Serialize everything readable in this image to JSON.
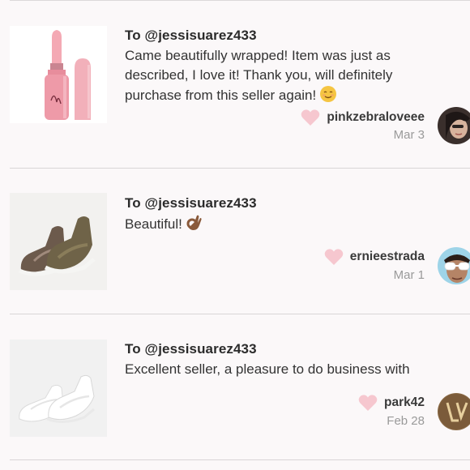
{
  "reviews": [
    {
      "to": "To @jessisuarez433",
      "text": "Came beautifully wrapped! Item was just as described, I love it! Thank you, will definitely purchase from this seller again!",
      "emoji": "relieved-smile-emoji",
      "username": "pinkzebraloveee",
      "date": "Mar 3",
      "thumb": "lipstick-image",
      "avatar": "user-photo-avatar"
    },
    {
      "to": "To @jessisuarez433",
      "text": "Beautiful!",
      "emoji": "ok-hand-emoji",
      "username": "ernieestrada",
      "date": "Mar 1",
      "thumb": "olive-sneakers-image",
      "avatar": "sunglasses-avatar"
    },
    {
      "to": "To @jessisuarez433",
      "text": "Excellent seller, a pleasure to do business with",
      "username": "park42",
      "date": "Feb 28",
      "thumb": "white-sneakers-image",
      "avatar": "monogram-avatar"
    }
  ],
  "colors": {
    "heart": "#f6c7cf",
    "background": "#fbf8f9",
    "divider": "#d9d5d7"
  }
}
